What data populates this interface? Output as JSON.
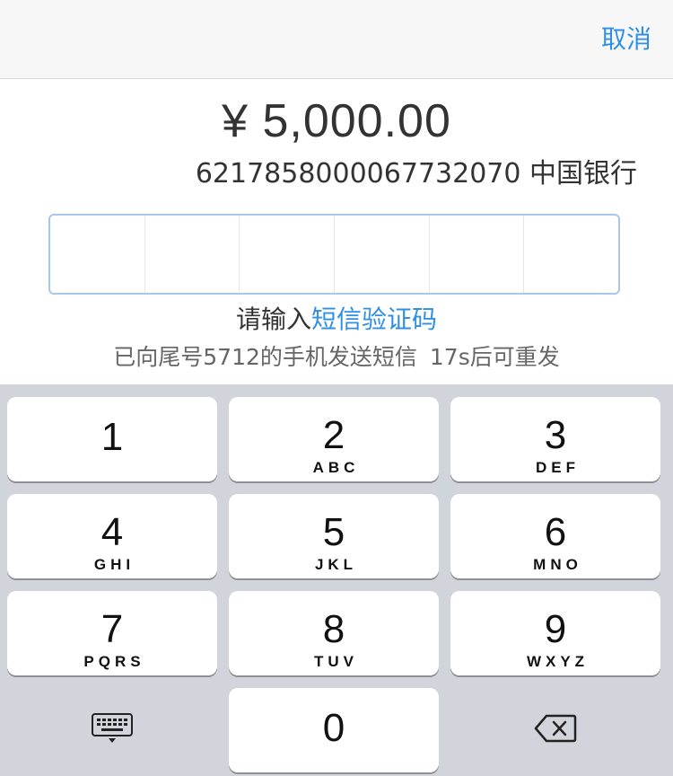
{
  "header": {
    "cancel_label": "取消"
  },
  "payment": {
    "amount": "¥ 5,000.00",
    "card_info": "6217858000067732070 中国银行"
  },
  "verification": {
    "code_digits": [
      "",
      "",
      "",
      "",
      "",
      ""
    ],
    "prompt_prefix": "请输入",
    "prompt_highlight": "短信验证码",
    "sms_note": "已向尾号5712的手机发送短信",
    "resend_countdown": "17s后可重发"
  },
  "colors": {
    "accent": "#2f8fe6",
    "keyboard_bg": "#d1d4da",
    "key_bg": "#ffffff"
  },
  "keypad": {
    "keys": [
      {
        "digit": "1",
        "letters": ""
      },
      {
        "digit": "2",
        "letters": "ABC"
      },
      {
        "digit": "3",
        "letters": "DEF"
      },
      {
        "digit": "4",
        "letters": "GHI"
      },
      {
        "digit": "5",
        "letters": "JKL"
      },
      {
        "digit": "6",
        "letters": "MNO"
      },
      {
        "digit": "7",
        "letters": "PQRS"
      },
      {
        "digit": "8",
        "letters": "TUV"
      },
      {
        "digit": "9",
        "letters": "WXYZ"
      },
      {
        "digit": "0",
        "letters": ""
      }
    ],
    "left_icon": "keyboard-hide-icon",
    "right_icon": "backspace-icon"
  }
}
